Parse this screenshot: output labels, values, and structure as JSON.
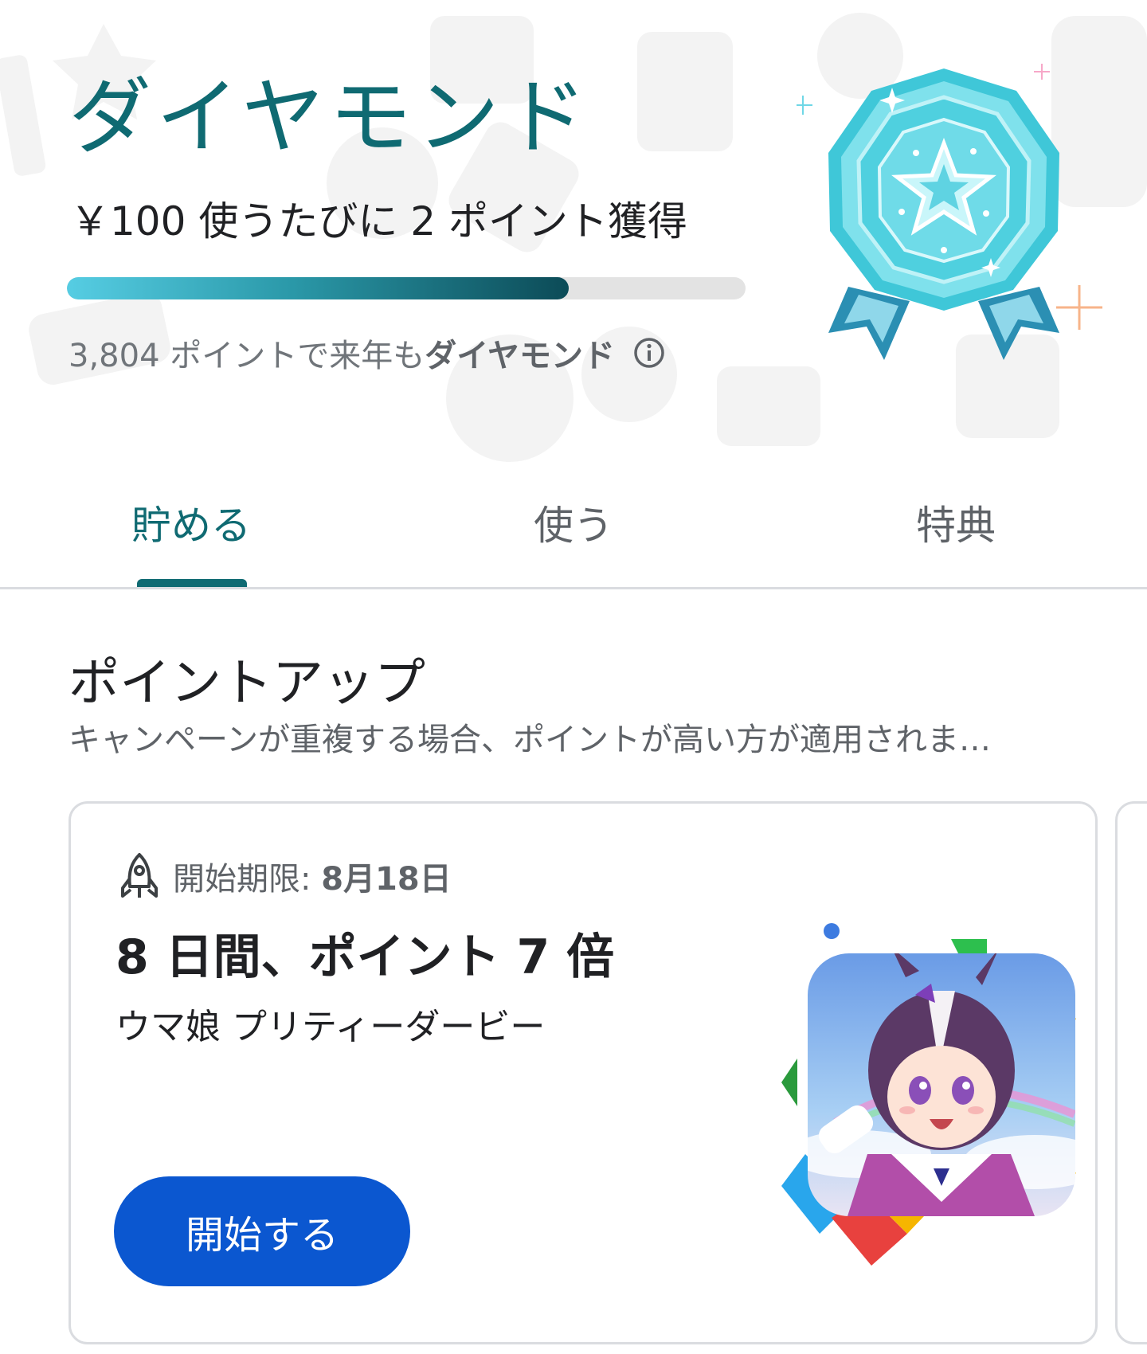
{
  "tier": {
    "name": "ダイヤモンド",
    "earn_rate": "￥100 使うたびに 2 ポイント獲得",
    "progress": 0.74,
    "status_points": "3,804 ポイントで来年も",
    "status_tier": "ダイヤモンド",
    "colors": {
      "tier": "#0f6a72",
      "progress_start": "#56cde3",
      "progress_end": "#0c4b57",
      "badge": "#5fd9e6"
    }
  },
  "tabs": [
    {
      "label": "貯める",
      "active": true
    },
    {
      "label": "使う",
      "active": false
    },
    {
      "label": "特典",
      "active": false
    }
  ],
  "section": {
    "title": "ポイントアップ",
    "subtitle": "キャンペーンが重複する場合、ポイントが高い方が適用されま…"
  },
  "promo": {
    "deadline_label": "開始期限:",
    "deadline_date": "8月18日",
    "title": "8 日間、ポイント 7 倍",
    "app_name": "ウマ娘 プリティーダービー",
    "button_label": "開始する",
    "button_color": "#0b57d0"
  }
}
